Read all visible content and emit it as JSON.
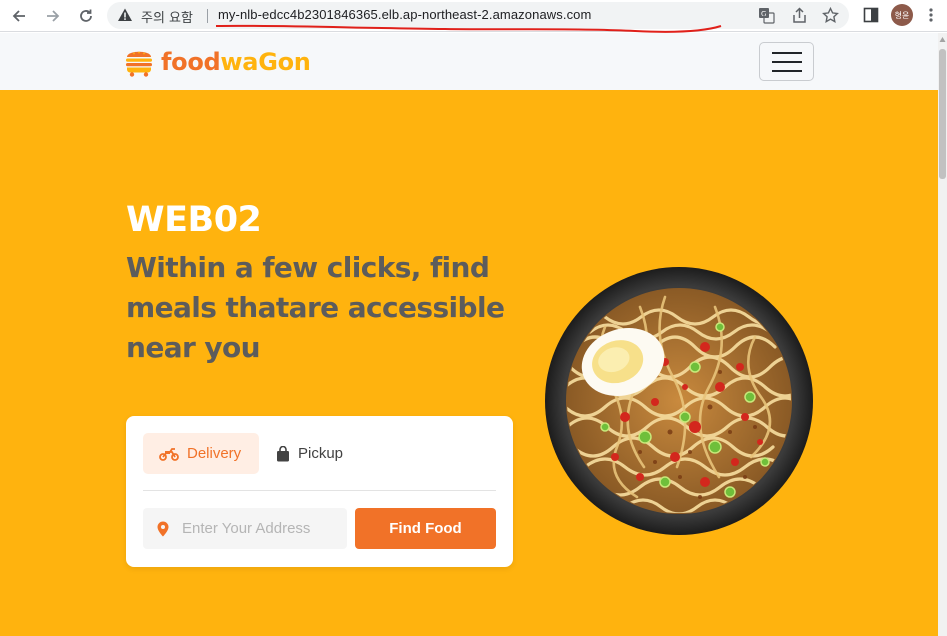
{
  "browser": {
    "security_label": "주의 요함",
    "url": "my-nlb-edcc4b2301846365.elb.ap-northeast-2.amazonaws.com",
    "avatar_text": "형윤"
  },
  "site": {
    "logo_part1": "food",
    "logo_part2": "wa",
    "logo_part3": "Gon",
    "hero_title": "WEB02",
    "hero_subtitle": "Within a few clicks, find meals thatare accessible near you",
    "tabs": [
      {
        "label": "Delivery",
        "icon": "motorcycle-icon",
        "active": true
      },
      {
        "label": "Pickup",
        "icon": "bag-icon",
        "active": false
      }
    ],
    "address_placeholder": "Enter Your Address",
    "address_value": "",
    "find_button": "Find Food"
  },
  "colors": {
    "hero_bg": "#ffb30e",
    "brand_orange": "#f17228",
    "navbar_bg": "#f6f8fa",
    "subtitle_text": "#5c5c5c",
    "delivery_tab_bg": "#ffeee4"
  }
}
